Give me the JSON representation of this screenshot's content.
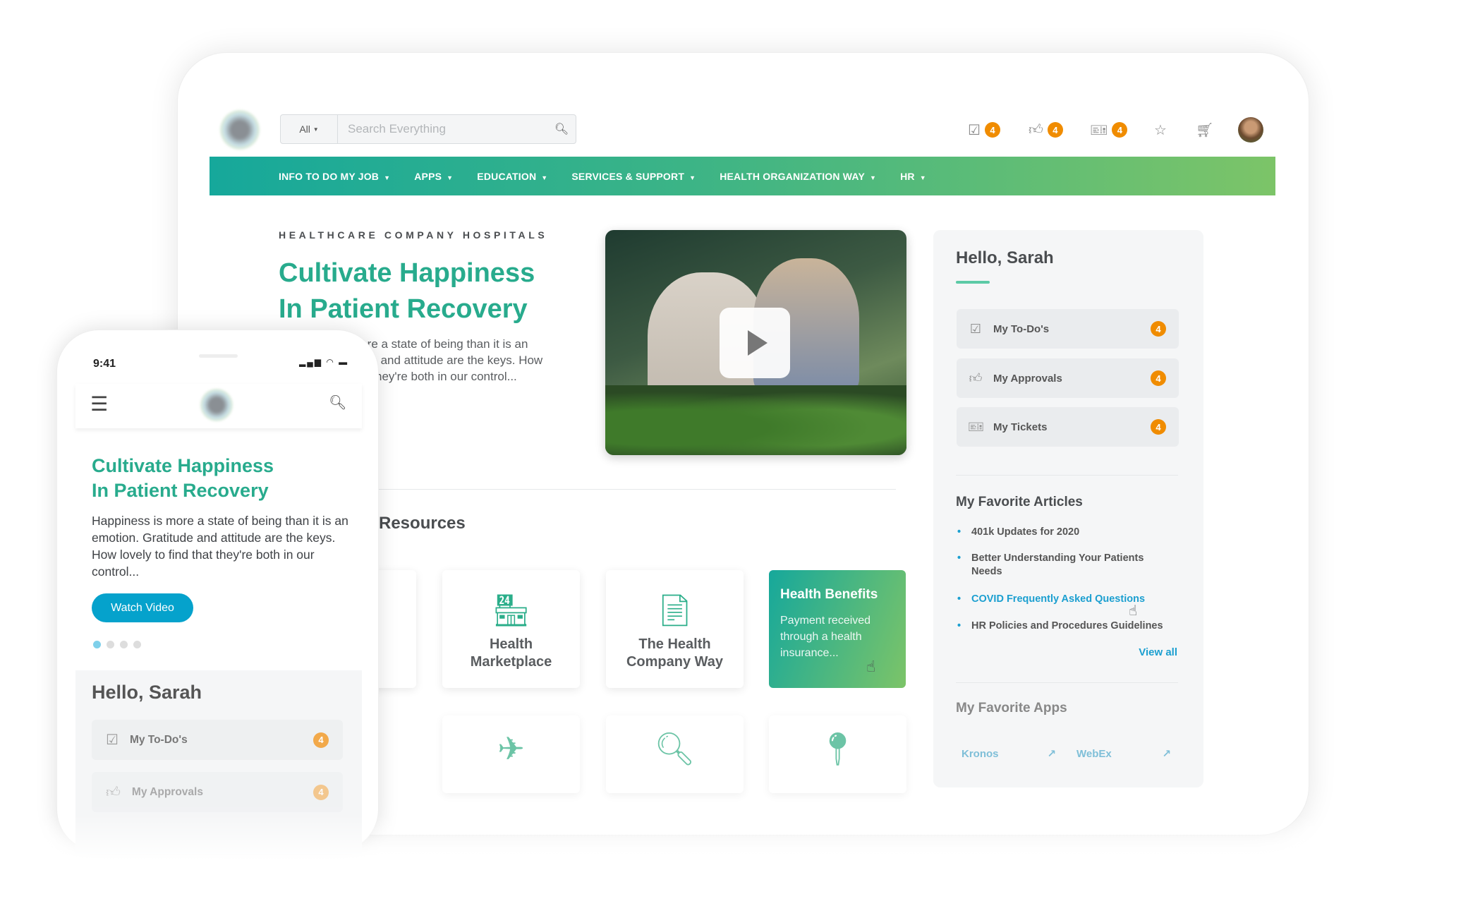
{
  "header": {
    "search": {
      "scope": "All",
      "placeholder": "Search Everything",
      "icon": "search-icon"
    },
    "icons": [
      {
        "name": "todo-icon",
        "count": "4"
      },
      {
        "name": "thumbs-up-icon",
        "count": "4"
      },
      {
        "name": "ticket-icon",
        "count": "4"
      },
      {
        "name": "star-icon"
      },
      {
        "name": "cart-icon"
      }
    ]
  },
  "nav": [
    "INFO TO DO MY JOB",
    "APPS",
    "EDUCATION",
    "SERVICES & SUPPORT",
    "HEALTH ORGANIZATION WAY",
    "HR"
  ],
  "hero": {
    "eyebrow": "HEALTHCARE COMPANY HOSPITALS",
    "title_1": "Cultivate Happiness",
    "title_2": "In Patient Recovery",
    "body": "Happiness is more a state of being than it is an emotion. Gratitude and attitude are the keys. How lovely to find that they're both in our control..."
  },
  "resources": {
    "heading": "Resources",
    "cards": [
      "Health Marketplace",
      "The Health Company Way"
    ],
    "featured": {
      "title": "Health Benefits",
      "text": "Payment received through a health insurance..."
    }
  },
  "panel": {
    "greeting": "Hello, Sarah",
    "items": [
      {
        "label": "My To-Do's",
        "count": "4"
      },
      {
        "label": "My Approvals",
        "count": "4"
      },
      {
        "label": "My Tickets",
        "count": "4"
      }
    ],
    "articles_title": "My Favorite Articles",
    "articles": [
      "401k Updates for 2020",
      "Better Understanding Your Patients Needs",
      "COVID Frequently Asked Questions",
      "HR Policies and Procedures Guidelines"
    ],
    "view_all": "View all",
    "apps_title": "My Favorite Apps",
    "apps": [
      "Kronos",
      "WebEx"
    ]
  },
  "mobile": {
    "time": "9:41",
    "title_1": "Cultivate Happiness",
    "title_2": "In Patient Recovery",
    "body": "Happiness is more a state of being than it is an emotion. Gratitude and attitude are the keys. How lovely to find that they're both in our control...",
    "button": "Watch Video",
    "carousel_active": 1,
    "carousel_total": 4,
    "greeting": "Hello, Sarah",
    "items": [
      {
        "label": "My To-Do's",
        "count": "4"
      },
      {
        "label": "My Approvals",
        "count": "4"
      }
    ]
  },
  "colors": {
    "accent": "#28ab8d",
    "badge": "#f08c00",
    "link": "#1b9fd0",
    "button": "#05a2cc"
  }
}
